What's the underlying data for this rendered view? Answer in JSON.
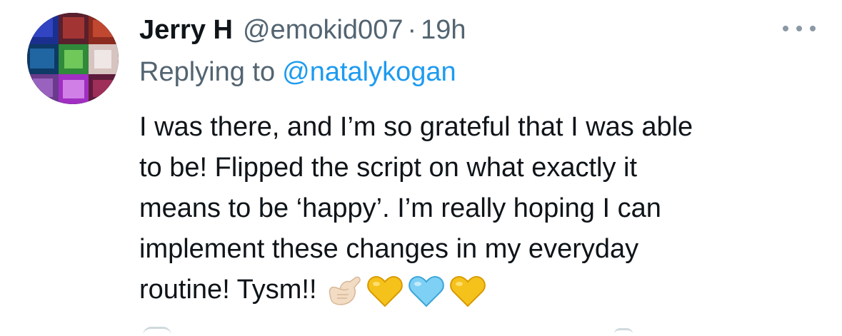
{
  "tweet": {
    "display_name": "Jerry H",
    "handle": "@emokid007",
    "separator": "·",
    "time": "19h",
    "reply_prefix": "Replying to",
    "reply_to": "@natalykogan",
    "body_lines": [
      "I was there, and I’m so grateful that I was able",
      "to be! Flipped the script on what exactly it",
      "means to be ‘happy’. I’m really hoping I can",
      "implement these changes in my everyday",
      "routine! Tysm!!"
    ],
    "emojis": [
      "call-me-hand-icon",
      "yellow-heart-icon",
      "light-blue-heart-icon",
      "yellow-heart-icon"
    ]
  },
  "colors": {
    "text_primary": "#0f1419",
    "text_secondary": "#536471",
    "link": "#1d9bf0",
    "more_dots": "#8b98a5"
  },
  "icons": {
    "more": "more-options-icon",
    "avatar": "avatar"
  }
}
